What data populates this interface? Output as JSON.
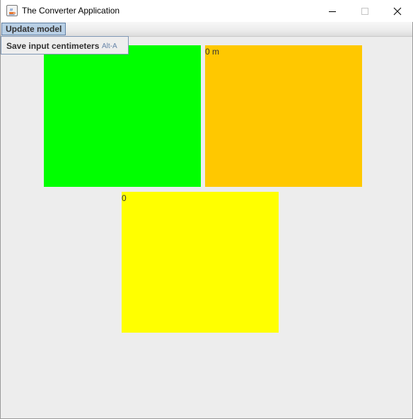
{
  "window": {
    "title": "The Converter Application",
    "icon": "java-app-icon"
  },
  "window_controls": {
    "minimize_icon": "minimize-icon",
    "maximize_icon": "maximize-icon",
    "close_icon": "close-icon"
  },
  "menubar": {
    "menus": [
      {
        "label": "Update model",
        "open": true
      }
    ]
  },
  "dropdown": {
    "items": [
      {
        "label": "Save input centimeters",
        "accelerator": "Alt-A"
      }
    ]
  },
  "panels": {
    "green": {
      "text": "",
      "color": "#00ff00"
    },
    "orange": {
      "text": "0 m",
      "color": "#ffc800"
    },
    "yellow": {
      "text": "0",
      "color": "#ffff00"
    }
  },
  "colors": {
    "menu_selected_bg": "#b8cfe5",
    "accelerator_text": "#6684a8"
  }
}
